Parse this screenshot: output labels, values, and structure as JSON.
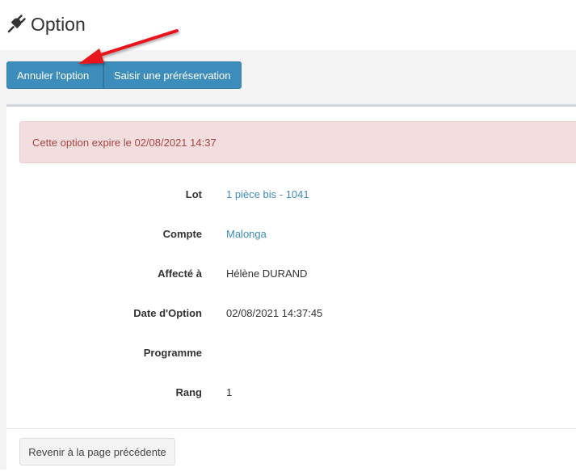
{
  "header": {
    "title": "Option",
    "icon": "plug-icon"
  },
  "actions": {
    "cancel_label": "Annuler l'option",
    "prereservation_label": "Saisir une préréservation"
  },
  "alert": {
    "text": "Cette option expire le 02/08/2021 14:37"
  },
  "details": [
    {
      "label": "Lot",
      "value": "1 pièce bis - 1041",
      "link": true
    },
    {
      "label": "Compte",
      "value": "Malonga",
      "link": true
    },
    {
      "label": "Affecté à",
      "value": "Hélène DURAND",
      "link": false
    },
    {
      "label": "Date d'Option",
      "value": "02/08/2021 14:37:45",
      "link": false
    },
    {
      "label": "Programme",
      "value": "",
      "link": false
    },
    {
      "label": "Rang",
      "value": "1",
      "link": false
    }
  ],
  "footer": {
    "back_label": "Revenir à la page précédente"
  },
  "colors": {
    "primary": "#3c8dbc",
    "alert_bg": "#f2dede",
    "alert_text": "#a94442",
    "annotation_arrow": "#e8121a"
  }
}
